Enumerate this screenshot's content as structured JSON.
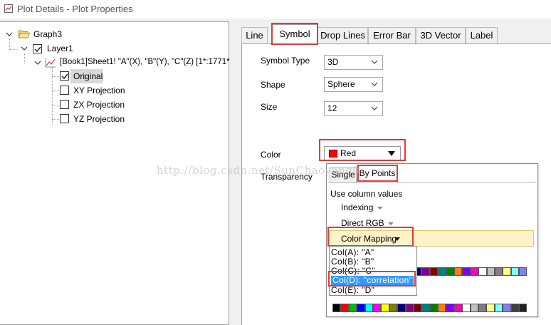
{
  "window": {
    "title": "Plot Details - Plot Properties"
  },
  "tree": {
    "graph": "Graph3",
    "layer": "Layer1",
    "plot": "[Book1]Sheet1! \"A\"(X), \"B\"(Y), \"C\"(Z) [1*:1771*",
    "children": [
      {
        "label": "Original",
        "checked": true,
        "selected": true
      },
      {
        "label": "XY Projection",
        "checked": false
      },
      {
        "label": "ZX Projection",
        "checked": false
      },
      {
        "label": "YZ Projection",
        "checked": false
      }
    ]
  },
  "tabs": [
    "Line",
    "Symbol",
    "Drop Lines",
    "Error Bar",
    "3D Vector",
    "Label"
  ],
  "active_tab": "Symbol",
  "symbol": {
    "type_label": "Symbol Type",
    "type_value": "3D",
    "shape_label": "Shape",
    "shape_value": "Sphere",
    "size_label": "Size",
    "size_value": "12",
    "color_label": "Color",
    "color_value": "Red",
    "color_hex": "#ff0000",
    "transparency_label": "Transparency"
  },
  "color_popup": {
    "tabs": [
      "Single",
      "By Points"
    ],
    "active_tab": "By Points",
    "section_label": "Use column values",
    "indexing": "Indexing",
    "direct_rgb": "Direct RGB",
    "color_mapping": "Color Mapping",
    "palette_row1": [
      "#000000",
      "#ff0000",
      "#00c000",
      "#0000ff",
      "#00ffff",
      "#ff00ff",
      "#ffff00",
      "#808000",
      "#000080",
      "#800080",
      "#800000",
      "#008080",
      "#008000",
      "#ff8000",
      "#8000ff",
      "#ff00c0",
      "#ffffff",
      "#c0c0c0",
      "#808080",
      "#ffff80",
      "#80ffff",
      "#8080ff",
      "#404040",
      "#202020"
    ],
    "palette_row2": [
      "#000000",
      "#ff0000",
      "#00c000",
      "#0000ff",
      "#00ffff",
      "#ff00ff",
      "#ffff00",
      "#808000",
      "#000080",
      "#800080",
      "#800000",
      "#008080",
      "#008000",
      "#ff8000",
      "#8000ff",
      "#ff00c0",
      "#ffffff",
      "#c0c0c0",
      "#808080",
      "#ffff80",
      "#80ffff",
      "#8080ff",
      "#404040",
      "#202020"
    ]
  },
  "column_list": [
    {
      "label": "Col(A): \"A\"",
      "selected": false
    },
    {
      "label": "Col(B): \"B\"",
      "selected": false
    },
    {
      "label": "Col(C): \"C\"",
      "selected": false
    },
    {
      "label": "Col(D): \"correlation\"",
      "selected": true
    },
    {
      "label": "Col(E): \"D\"",
      "selected": false
    }
  ],
  "watermark": "http://blog.csdn.net/SunChaoyang0"
}
